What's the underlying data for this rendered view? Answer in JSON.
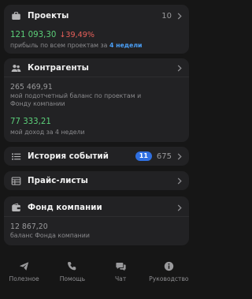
{
  "projects": {
    "icon": "briefcase-icon",
    "title": "Проекты",
    "count": "10",
    "profit_value": "121 093,30",
    "profit_change": "39,49%",
    "caption_prefix": "прибыль по всем проектам за",
    "caption_period": "4 недели"
  },
  "contractors": {
    "icon": "people-icon",
    "title": "Контрагенты",
    "balance_value": "265 469,91",
    "balance_caption_1": "мой подотчетный баланс по проектам и",
    "balance_caption_2": "Фонду компании",
    "income_value": "77 333,21",
    "income_caption": "мой доход за 4 недели"
  },
  "history": {
    "icon": "list-icon",
    "title": "История событий",
    "badge": "11",
    "count": "675"
  },
  "pricelists": {
    "icon": "table-icon",
    "title": "Прайс-листы"
  },
  "fund": {
    "icon": "wallet-icon",
    "title": "Фонд компании",
    "value": "12 867,20",
    "caption": "баланс Фонда компании"
  },
  "tabs": [
    {
      "icon": "send-icon",
      "label": "Полезное"
    },
    {
      "icon": "phone-icon",
      "label": "Помощь"
    },
    {
      "icon": "chat-icon",
      "label": "Чат"
    },
    {
      "icon": "info-icon",
      "label": "Руководство"
    }
  ],
  "colors": {
    "background": "#161616",
    "card": "#222224",
    "positive": "#5cd07a",
    "negative": "#e8605a",
    "accent": "#4a9ef5",
    "badge": "#2f6fe0"
  }
}
